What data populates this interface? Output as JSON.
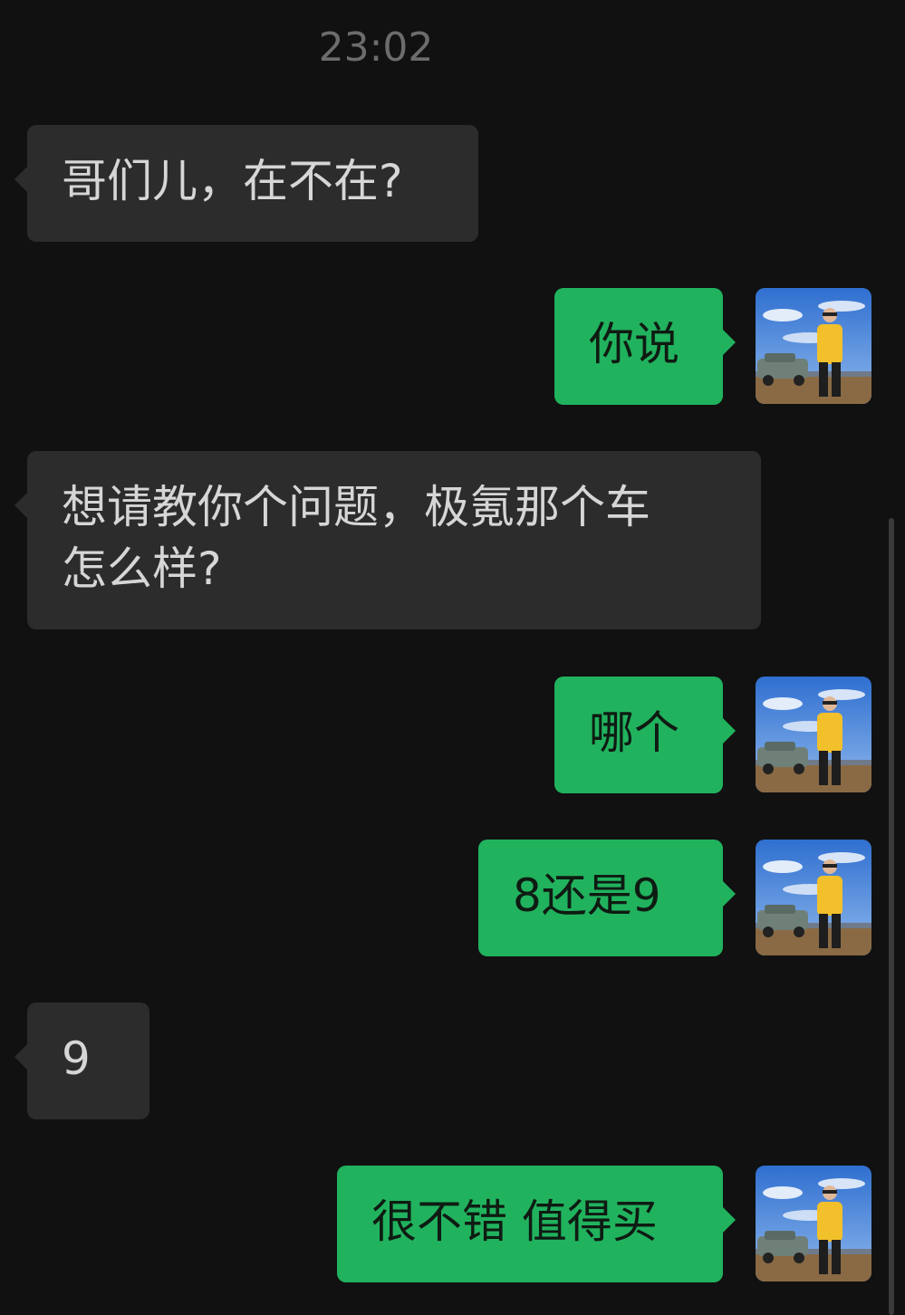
{
  "chat": {
    "timestamp": "23:02",
    "messages": [
      {
        "direction": "incoming",
        "text": "哥们儿，在不在?"
      },
      {
        "direction": "outgoing",
        "text": "你说"
      },
      {
        "direction": "incoming",
        "text": "想请教你个问题，极氪那个车\n怎么样?"
      },
      {
        "direction": "outgoing",
        "text": "哪个"
      },
      {
        "direction": "outgoing",
        "text": "8还是9"
      },
      {
        "direction": "incoming",
        "text": "9"
      },
      {
        "direction": "outgoing",
        "text": "很不错 值得买"
      }
    ]
  },
  "colors": {
    "background": "#111111",
    "incoming_bubble": "#2c2c2c",
    "outgoing_bubble": "#21b25e"
  },
  "avatar": {
    "icon": "user-avatar-photo"
  }
}
